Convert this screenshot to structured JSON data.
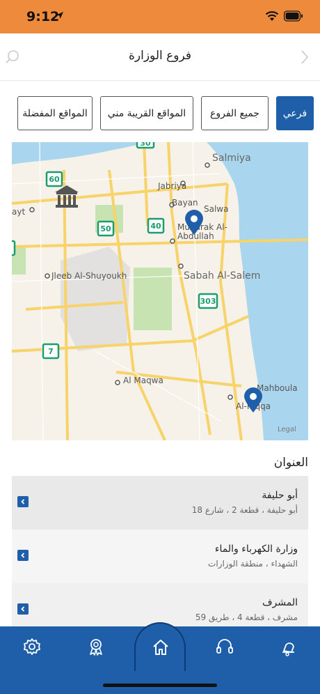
{
  "status_bar": {
    "time": "9:12"
  },
  "header": {
    "title": "فروع الوزارة"
  },
  "filters": [
    {
      "label": "فرعي",
      "active": true
    },
    {
      "label": "جميع الفروع",
      "active": false
    },
    {
      "label": "المواقع القريبة مني",
      "active": false
    },
    {
      "label": "المواقع المفضلة",
      "active": false
    }
  ],
  "map": {
    "labels": {
      "salmiya": "Salmiya",
      "jabriya": "Jabriya",
      "bayan": "Bayan",
      "salwa": "Salwa",
      "mubarak": "Mubarak Al-",
      "abdullah": "Abdullah",
      "sabah": "Sabah Al-Salem",
      "jleeb": "Jleeb Al-Shuyoukh",
      "maqwa": "Al Maqwa",
      "mahboula": "Mahboula",
      "adan": "Al-Riqqa",
      "ayt": "ayt",
      "legal": "Legal"
    },
    "road_shields": [
      "60",
      "50",
      "40",
      "303",
      "7",
      "30"
    ],
    "colors": {
      "water": "#a9d6ee",
      "land": "#f6f2e9",
      "park": "#c7e3b1",
      "road": "#f7d36a",
      "pin": "#1f5faa",
      "shield": "#1b9d6e"
    }
  },
  "address_section": {
    "title": "العنوان",
    "items": [
      {
        "name": "أبو حليفة",
        "detail": "أبو حليفة ، قطعة 2 ، شارع 18"
      },
      {
        "name": "وزارة الكهرباء والماء",
        "detail": "الشهداء ، منطقة الوزارات"
      },
      {
        "name": "المشرف",
        "detail": "مشرف ، قطعة 4 ، طريق 59"
      }
    ]
  },
  "tab_bar": {
    "icons": [
      "gear-icon",
      "award-icon",
      "home-icon",
      "headset-icon",
      "bell-icon"
    ]
  }
}
